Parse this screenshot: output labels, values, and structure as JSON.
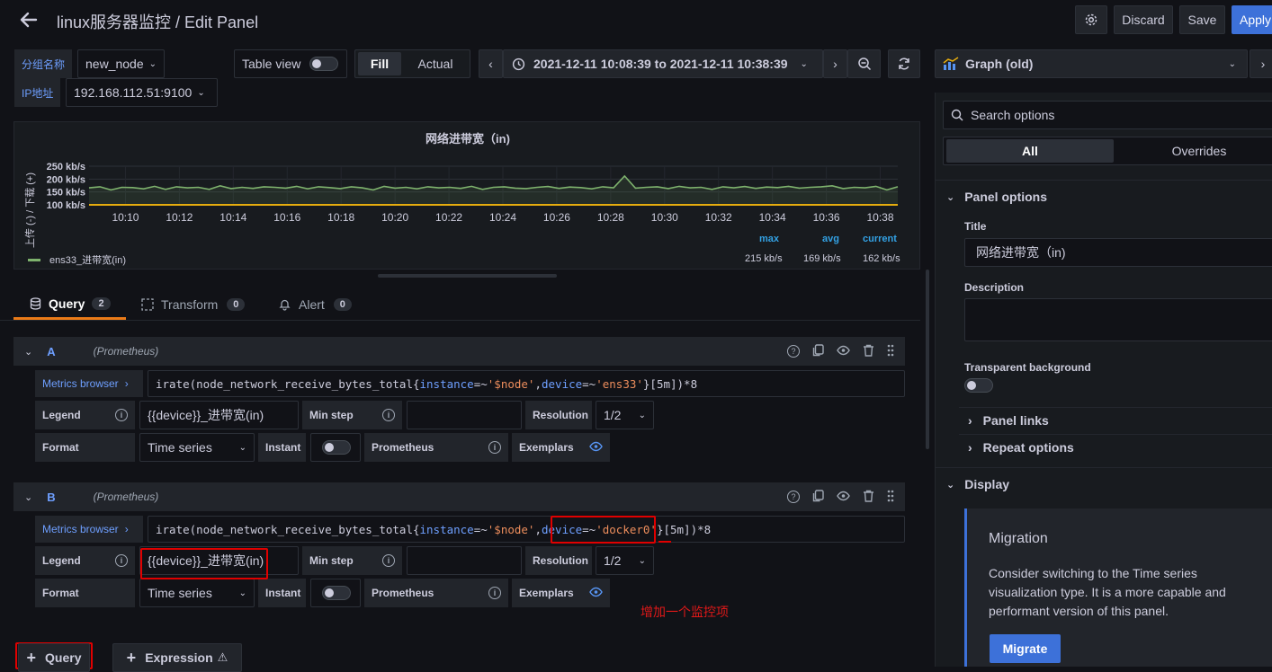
{
  "header": {
    "title": "linux服务器监控 / Edit Panel",
    "discard_label": "Discard",
    "save_label": "Save",
    "apply_label": "Apply"
  },
  "variables": [
    {
      "label": "分组名称",
      "value": "new_node"
    },
    {
      "label": "IP地址",
      "value": "192.168.112.51:9100"
    }
  ],
  "toolbar": {
    "table_view_label": "Table view",
    "fill_label": "Fill",
    "actual_label": "Actual",
    "time_range": "2021-12-11 10:08:39 to 2021-12-11 10:38:39"
  },
  "viz_picker": {
    "label": "Graph (old)"
  },
  "chart": {
    "title": "网络进带宽（in)",
    "ylabel": "上传 (-) / 下载 (+)",
    "legend_headers": [
      "max",
      "avg",
      "current"
    ],
    "legend_series": "ens33_进带宽(in)",
    "legend_values": [
      "215 kb/s",
      "169 kb/s",
      "162 kb/s"
    ]
  },
  "chart_data": {
    "type": "line",
    "title": "网络进带宽（in)",
    "ylabel": "上传 (-) / 下载 (+)",
    "x_ticks": [
      "10:10",
      "10:12",
      "10:14",
      "10:16",
      "10:18",
      "10:20",
      "10:22",
      "10:24",
      "10:26",
      "10:28",
      "10:30",
      "10:32",
      "10:34",
      "10:36",
      "10:38"
    ],
    "y_ticks": [
      "250 kb/s",
      "200 kb/s",
      "150 kb/s",
      "100 kb/s"
    ],
    "ylim": [
      100,
      250
    ],
    "x_start_minute": 8.65,
    "x_end_minute": 38.65,
    "series": [
      {
        "name": "ens33_进带宽(in)",
        "color": "#7eb26d",
        "values": [
          166,
          170,
          158,
          168,
          167,
          162,
          172,
          160,
          170,
          166,
          168,
          160,
          174,
          163,
          168,
          164,
          170,
          168,
          165,
          172,
          162,
          170,
          167,
          163,
          170,
          166,
          158,
          172,
          165,
          168,
          162,
          170,
          166,
          168,
          164,
          172,
          160,
          168,
          170,
          165,
          163,
          168,
          171,
          164,
          169,
          167,
          162,
          170,
          166,
          212,
          165,
          168,
          170,
          163,
          172,
          166,
          168,
          160,
          170,
          166,
          171,
          164,
          169,
          167,
          172,
          165,
          168,
          170,
          174,
          163,
          168,
          166,
          172,
          158,
          170
        ]
      },
      {
        "color": "#e5ac0e",
        "values": [
          100,
          100,
          100,
          100,
          100,
          100,
          100,
          100,
          100,
          100,
          100,
          100,
          100,
          100,
          100,
          100,
          100,
          100,
          100,
          100,
          100,
          100,
          100,
          100,
          100,
          100,
          100,
          100,
          100,
          100,
          100,
          100,
          100,
          100,
          100,
          100,
          100,
          100,
          100,
          100,
          100,
          100,
          100,
          100,
          100,
          100,
          100,
          100,
          100,
          100,
          100,
          100,
          100,
          100,
          100,
          100,
          100,
          100,
          100,
          100,
          100,
          100,
          100,
          100,
          100,
          100,
          100,
          100,
          100,
          100,
          100,
          100,
          100,
          100,
          100
        ]
      }
    ]
  },
  "tabs": [
    {
      "label": "Query",
      "count": "2"
    },
    {
      "label": "Transform",
      "count": "0"
    },
    {
      "label": "Alert",
      "count": "0"
    }
  ],
  "queries": [
    {
      "ref": "A",
      "datasource": "(Prometheus)",
      "metrics_browser": "Metrics browser",
      "expr_prefix": "irate(node_network_receive_bytes_total{",
      "expr_k1": "instance",
      "expr_op1": "=~",
      "expr_v1": "'$node'",
      "expr_sep": ",",
      "expr_k2": "device",
      "expr_op2": "=~",
      "expr_v2": "'ens33'",
      "expr_suffix": "}[5m])*8",
      "legend_label": "Legend",
      "legend_value": "{{device}}_进带宽(in)",
      "min_step_label": "Min step",
      "resolution_label": "Resolution",
      "resolution_value": "1/2",
      "format_label": "Format",
      "format_value": "Time series",
      "instant_label": "Instant",
      "prometheus_label": "Prometheus",
      "exemplars_label": "Exemplars"
    },
    {
      "ref": "B",
      "datasource": "(Prometheus)",
      "metrics_browser": "Metrics browser",
      "expr_prefix": "irate(node_network_receive_bytes_total{",
      "expr_k1": "instance",
      "expr_op1": "=~",
      "expr_v1": "'$node'",
      "expr_sep": ",",
      "expr_k2": "device",
      "expr_op2": "=~",
      "expr_v2": "'docker0'",
      "expr_suffix": "}[5m])*8",
      "legend_label": "Legend",
      "legend_value": "{{device}}_进带宽(in)",
      "min_step_label": "Min step",
      "resolution_label": "Resolution",
      "resolution_value": "1/2",
      "format_label": "Format",
      "format_value": "Time series",
      "instant_label": "Instant",
      "prometheus_label": "Prometheus",
      "exemplars_label": "Exemplars"
    }
  ],
  "annotation_text": "增加一个监控项",
  "add_query_label": "Query",
  "add_expression_label": "Expression",
  "options": {
    "search_placeholder": "Search options",
    "tab_all": "All",
    "tab_overrides": "Overrides",
    "panel_options": "Panel options",
    "title_label": "Title",
    "title_value": "网络进带宽（in)",
    "description_label": "Description",
    "transparent_label": "Transparent background",
    "panel_links": "Panel links",
    "repeat_options": "Repeat options",
    "display": "Display",
    "migration_title": "Migration",
    "migration_text": "Consider switching to the Time series visualization type. It is a more capable and performant version of this panel.",
    "migrate_label": "Migrate"
  }
}
